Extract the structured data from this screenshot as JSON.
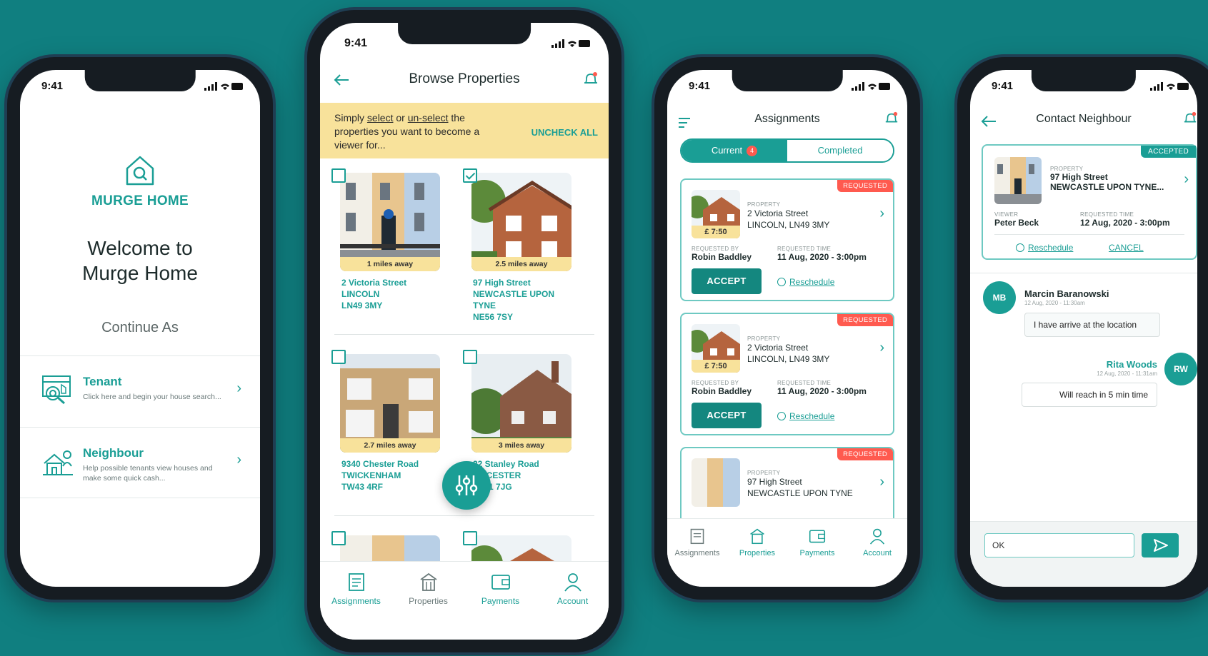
{
  "status": {
    "time": "9:41"
  },
  "welcome_screen": {
    "brand": "MURGE HOME",
    "welcome_text": "Welcome to Murge Home",
    "continue_as": "Continue As",
    "roles": [
      {
        "title": "Tenant",
        "description": "Click here and begin your house search..."
      },
      {
        "title": "Neighbour",
        "description": "Help possible tenants view houses and make some quick cash..."
      }
    ]
  },
  "browse_screen": {
    "title": "Browse Properties",
    "banner": {
      "pre": "Simply ",
      "select": "select",
      "or": " or ",
      "unselect": "un-select",
      "post": " the properties you want to become a viewer for...",
      "action": "UNCHECK ALL"
    },
    "properties": [
      {
        "distance": "1 miles away",
        "line1": "2 Victoria Street",
        "line2": "LINCOLN",
        "line3": "LN49 3MY",
        "checked": false
      },
      {
        "distance": "2.5 miles away",
        "line1": "97 High Street",
        "line2": "NEWCASTLE UPON TYNE",
        "line3": "NE56 7SY",
        "checked": true
      },
      {
        "distance": "2.7 miles away",
        "line1": "9340 Chester Road",
        "line2": "TWICKENHAM",
        "line3": "TW43 4RF",
        "checked": false
      },
      {
        "distance": "3 miles away",
        "line1": "22 Stanley Road",
        "line2": "LEICESTER",
        "line3": "LE21 7JG",
        "checked": false
      }
    ]
  },
  "nav": {
    "assignments": "Assignments",
    "properties": "Properties",
    "payments": "Payments",
    "account": "Account"
  },
  "assignments_screen": {
    "title": "Assignments",
    "tabs": {
      "current": "Current",
      "current_count": "4",
      "completed": "Completed"
    },
    "cards": [
      {
        "status": "REQUESTED",
        "price": "£ 7:50",
        "property_label": "PROPERTY",
        "address1": "2 Victoria Street",
        "address2": "LINCOLN, LN49 3MY",
        "requested_by_label": "REQUESTED BY",
        "requested_by": "Robin Baddley",
        "time_label": "REQUESTED TIME",
        "time": "11 Aug, 2020 - 3:00pm",
        "accept": "ACCEPT",
        "reschedule": "Reschedule"
      },
      {
        "status": "REQUESTED",
        "price": "£ 7:50",
        "property_label": "PROPERTY",
        "address1": "2 Victoria Street",
        "address2": "LINCOLN, LN49 3MY",
        "requested_by_label": "REQUESTED BY",
        "requested_by": "Robin Baddley",
        "time_label": "REQUESTED TIME",
        "time": "11 Aug, 2020 - 3:00pm",
        "accept": "ACCEPT",
        "reschedule": "Reschedule"
      },
      {
        "status": "REQUESTED",
        "property_label": "PROPERTY",
        "address1": "97 High Street",
        "address2": "NEWCASTLE UPON TYNE"
      }
    ]
  },
  "contact_screen": {
    "title": "Contact Neighbour",
    "card": {
      "status": "ACCEPTED",
      "property_label": "PROPERTY",
      "address1": "97 High Street",
      "address2": "NEWCASTLE UPON TYNE...",
      "viewer_label": "VIEWER",
      "viewer": "Peter Beck",
      "time_label": "REQUESTED TIME",
      "time": "12 Aug, 2020 - 3:00pm",
      "reschedule": "Reschedule",
      "cancel": "CANCEL"
    },
    "messages": [
      {
        "initials": "MB",
        "name": "Marcin Baranowski",
        "time": "12 Aug, 2020 - 11:30am",
        "text": "I have arrive at the location"
      },
      {
        "initials": "RW",
        "name": "Rita Woods",
        "time": "12 Aug, 2020 - 11:31am",
        "text": "Will reach in 5 min time"
      }
    ],
    "input_value": "OK"
  },
  "colors": {
    "background": "#107f80",
    "accent": "#1a9e95",
    "banner": "#f8e29b",
    "requested": "#ff5a4f"
  }
}
